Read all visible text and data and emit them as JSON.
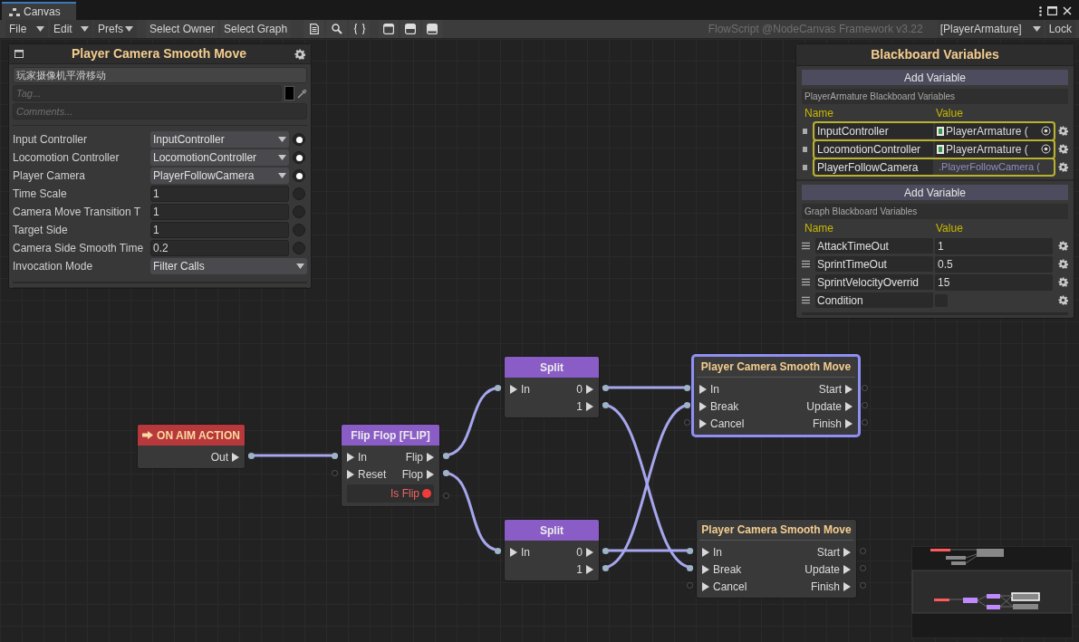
{
  "window": {
    "title": "Canvas"
  },
  "toolbar": {
    "menus": [
      {
        "label": "File"
      },
      {
        "label": "Edit"
      },
      {
        "label": "Prefs"
      }
    ],
    "buttons": [
      {
        "label": "Select Owner"
      },
      {
        "label": "Select Graph"
      }
    ],
    "framework_label": "FlowScript @NodeCanvas Framework v3.22",
    "owner": "[PlayerArmature]",
    "lock": "Lock"
  },
  "inspector": {
    "title": "Player Camera Smooth Move",
    "name": "玩家摄像机平滑移动",
    "tag_placeholder": "Tag...",
    "comments_placeholder": "Comments...",
    "params": [
      {
        "label": "Input Controller",
        "value": "InputController",
        "kind": "dropdown",
        "bound": true
      },
      {
        "label": "Locomotion Controller",
        "value": "LocomotionController",
        "kind": "dropdown",
        "bound": true
      },
      {
        "label": "Player Camera",
        "value": "PlayerFollowCamera",
        "kind": "dropdown",
        "bound": true
      },
      {
        "label": "Time Scale",
        "value": "1",
        "kind": "field",
        "bound": false
      },
      {
        "label": "Camera Move Transition T",
        "value": "1",
        "kind": "field",
        "bound": false
      },
      {
        "label": "Target Side",
        "value": "1",
        "kind": "field",
        "bound": false
      },
      {
        "label": "Camera Side Smooth Time",
        "value": "0.2",
        "kind": "field",
        "bound": false
      },
      {
        "label": "Invocation Mode",
        "value": "Filter Calls",
        "kind": "enum"
      }
    ]
  },
  "blackboard": {
    "title": "Blackboard Variables",
    "sections": [
      {
        "kind": "bound",
        "add_button": "Add Variable",
        "title": "PlayerArmature Blackboard Variables",
        "name_header": "Name",
        "value_header": "Value",
        "variables": [
          {
            "name": "InputController",
            "value": "PlayerArmature (",
            "kind": "object",
            "highlighted": true
          },
          {
            "name": "LocomotionController",
            "value": "PlayerArmature (",
            "kind": "object",
            "highlighted": true
          },
          {
            "name": "PlayerFollowCamera",
            "value": ".PlayerFollowCamera (",
            "kind": "reference",
            "highlighted": true
          }
        ]
      },
      {
        "kind": "graph",
        "add_button": "Add Variable",
        "title": "Graph Blackboard Variables",
        "name_header": "Name",
        "value_header": "Value",
        "variables": [
          {
            "name": "AttackTimeOut",
            "value": "1",
            "kind": "number",
            "highlighted": false
          },
          {
            "name": "SprintTimeOut",
            "value": "0.5",
            "kind": "number",
            "highlighted": false
          },
          {
            "name": "SprintVelocityOverrid",
            "value": "15",
            "kind": "number",
            "highlighted": false
          },
          {
            "name": "Condition",
            "kind": "bool",
            "checked": false,
            "highlighted": false
          }
        ]
      }
    ]
  },
  "nodes": [
    {
      "kind": "event",
      "title": "ON AIM ACTION",
      "outputs": [
        {
          "label": "Out"
        }
      ],
      "selected": false
    },
    {
      "kind": "flow",
      "title": "Flip Flop [FLIP]",
      "inputs": [
        {
          "label": "In"
        },
        {
          "label": "Reset"
        }
      ],
      "outputs": [
        {
          "label": "Flip"
        },
        {
          "label": "Flop"
        }
      ],
      "value_output": "Is Flip",
      "selected": false
    },
    {
      "kind": "flow",
      "title": "Split",
      "inputs": [
        {
          "label": "In"
        }
      ],
      "outputs": [
        {
          "label": "0"
        },
        {
          "label": "1"
        }
      ],
      "selected": false
    },
    {
      "kind": "flow",
      "title": "Split",
      "inputs": [
        {
          "label": "In"
        }
      ],
      "outputs": [
        {
          "label": "0"
        },
        {
          "label": "1"
        }
      ],
      "selected": false
    },
    {
      "kind": "action",
      "title": "Player Camera Smooth Move",
      "inputs": [
        {
          "label": "In"
        },
        {
          "label": "Break"
        },
        {
          "label": "Cancel"
        }
      ],
      "outputs": [
        {
          "label": "Start"
        },
        {
          "label": "Update"
        },
        {
          "label": "Finish"
        }
      ],
      "selected": true
    },
    {
      "kind": "action",
      "title": "Player Camera Smooth Move",
      "inputs": [
        {
          "label": "In"
        },
        {
          "label": "Break"
        },
        {
          "label": "Cancel"
        }
      ],
      "outputs": [
        {
          "label": "Start"
        },
        {
          "label": "Update"
        },
        {
          "label": "Finish"
        }
      ],
      "selected": false
    }
  ]
}
